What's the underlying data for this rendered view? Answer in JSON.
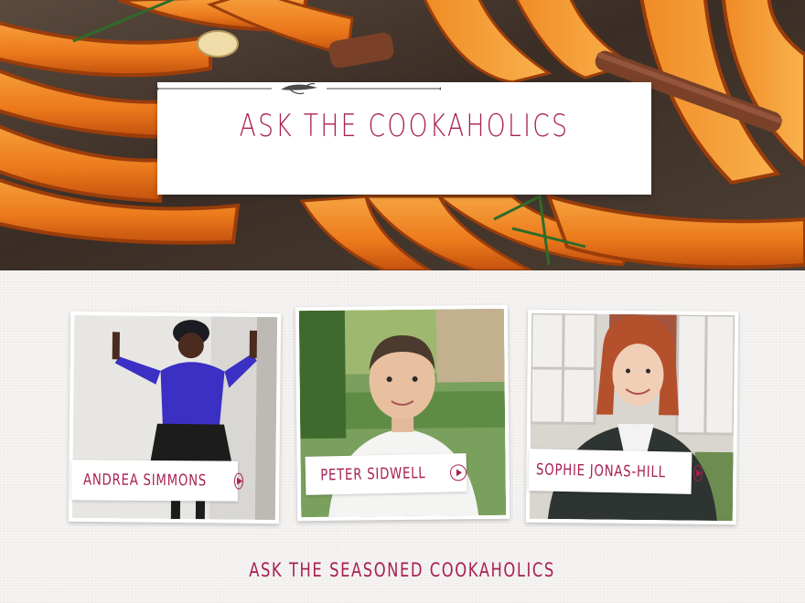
{
  "header": {
    "title": "ASK THE COOKAHOLICS"
  },
  "profiles": [
    {
      "name": "ANDREA SIMMONS",
      "action_icon": "play-circle-icon"
    },
    {
      "name": "PETER SIDWELL",
      "action_icon": "play-circle-icon"
    },
    {
      "name": "SOPHIE JONAS-HILL",
      "action_icon": "play-circle-icon"
    }
  ],
  "footer": {
    "link_label": "ASK THE SEASONED COOKAHOLICS"
  },
  "colors": {
    "accent": "#a82054",
    "background": "#f6f4f2",
    "card": "#ffffff"
  }
}
